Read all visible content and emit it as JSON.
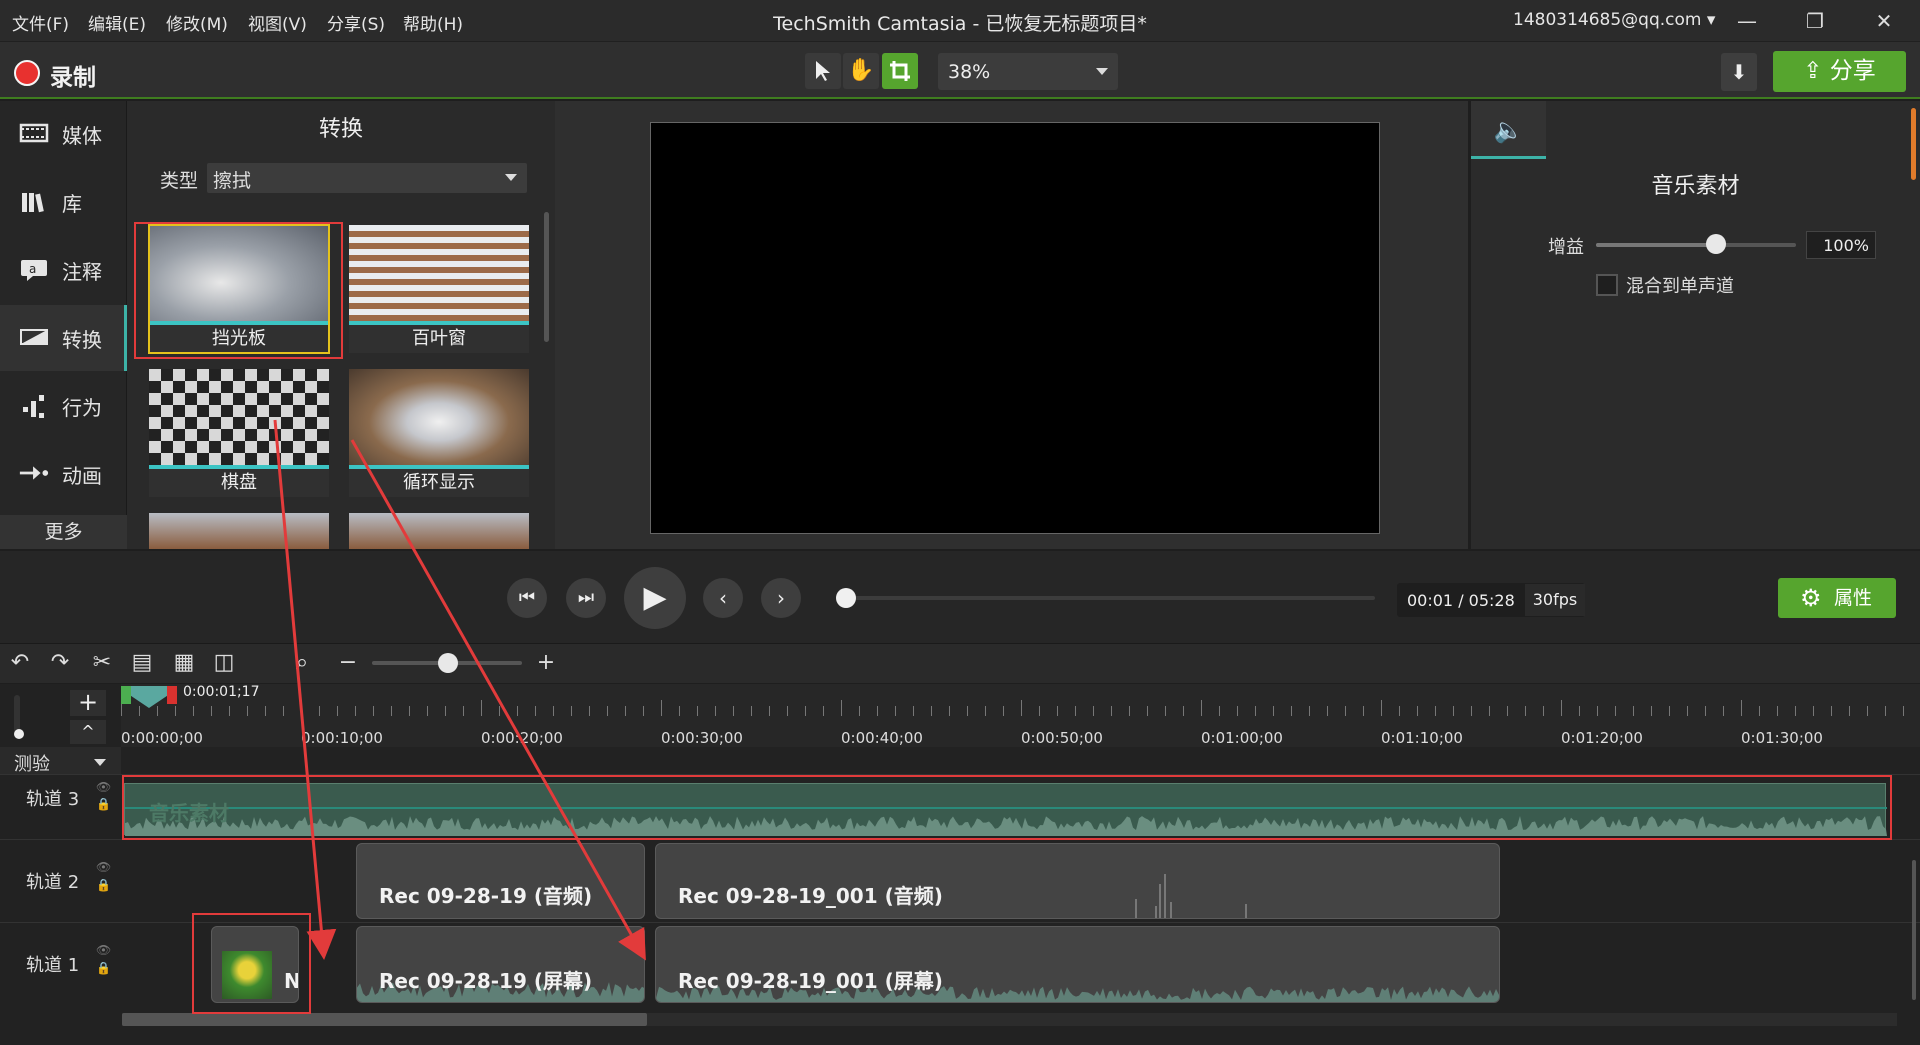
{
  "menubar": {
    "items": [
      "文件(F)",
      "编辑(E)",
      "修改(M)",
      "视图(V)",
      "分享(S)",
      "帮助(H)"
    ],
    "title": "TechSmith Camtasia - 已恢复无标题项目*",
    "account": "1480314685@qq.com ▾",
    "minimize": "—",
    "restore": "❐",
    "close": "✕"
  },
  "toolbar": {
    "record_label": "录制",
    "zoom": "38%",
    "share_label": "分享"
  },
  "nav": {
    "items": [
      {
        "label": "媒体",
        "icon": "film-icon"
      },
      {
        "label": "库",
        "icon": "library-icon"
      },
      {
        "label": "注释",
        "icon": "annotation-icon"
      },
      {
        "label": "转换",
        "icon": "transition-icon"
      },
      {
        "label": "行为",
        "icon": "behavior-icon"
      },
      {
        "label": "动画",
        "icon": "animation-icon"
      }
    ],
    "more": "更多"
  },
  "transitions": {
    "title": "转换",
    "type_label": "类型",
    "type_value": "擦拭",
    "items": [
      "挡光板",
      "百叶窗",
      "棋盘",
      "循环显示",
      "",
      ""
    ]
  },
  "properties": {
    "title": "音乐素材",
    "gain_label": "增益",
    "gain_value": "100%",
    "mono_label": "混合到单声道"
  },
  "playback": {
    "time": "00:01 / 05:28",
    "fps": "30fps",
    "attr_label": "属性",
    "progress": 0.0
  },
  "timeline": {
    "playhead_time": "0:00:01;17",
    "tick_labels": [
      "0:00:00;00",
      "0:00:10;00",
      "0:00:20;00",
      "0:00:30;00",
      "0:00:40;00",
      "0:00:50;00",
      "0:01:00;00",
      "0:01:10;00",
      "0:01:20;00",
      "0:01:30;00"
    ],
    "marker_label": "测验",
    "tracks": [
      "轨道 3",
      "轨道 2",
      "轨道 1"
    ],
    "music_clip": "音乐素材",
    "clips": {
      "t2a": "Rec 09-28-19 (音频)",
      "t2b": "Rec 09-28-19_001 (音频)",
      "t1a": "Rec 09-28-19 (屏幕)",
      "t1b": "Rec 09-28-19_001 (屏幕)",
      "t1n": "N"
    }
  },
  "colors": {
    "accent_green": "#56a52e",
    "teal": "#3db3a8",
    "annotation_red": "#e23b3b",
    "record_red": "#e8312f"
  }
}
